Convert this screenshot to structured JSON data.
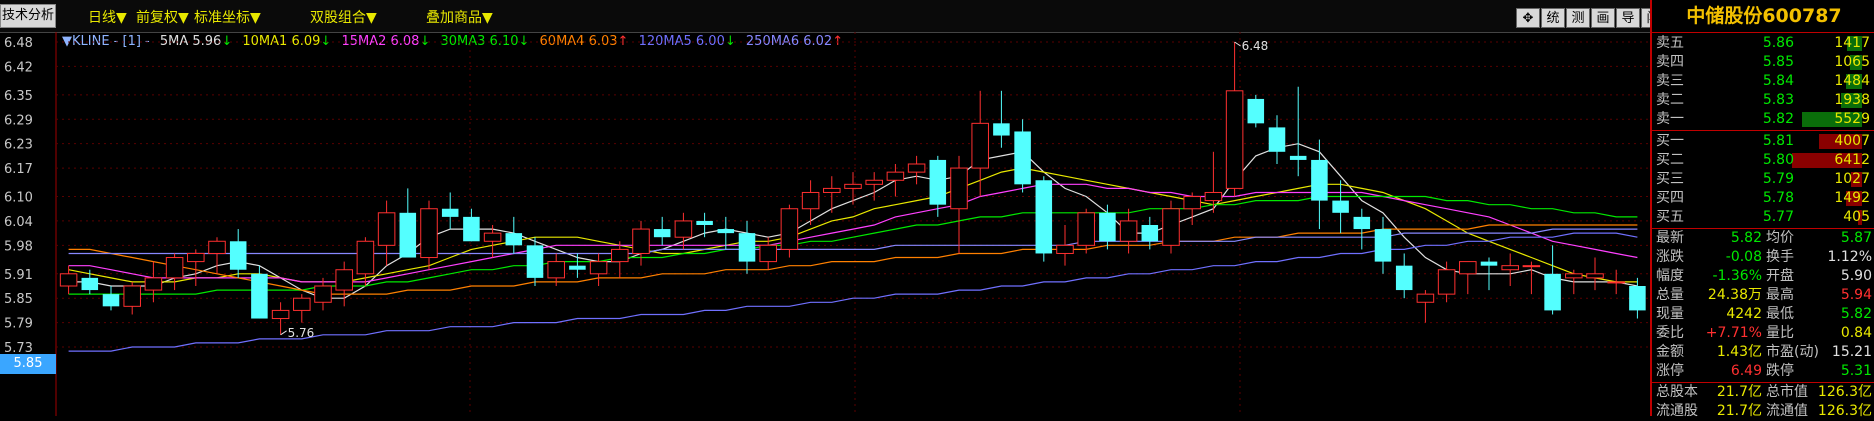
{
  "toolbar": {
    "left_tab": "技术分析",
    "menus": [
      {
        "label": "日线▼"
      },
      {
        "label": "前复权▼"
      },
      {
        "label": "标准坐标▼"
      },
      {
        "label": "双股组合▼"
      },
      {
        "label": "叠加商品▼"
      }
    ],
    "buttons": [
      "✥",
      "统",
      "测",
      "画",
      "导",
      "闯"
    ]
  },
  "legend": {
    "kline": "▼KLINE - [1] -",
    "items": [
      {
        "label": "5MA 5.96",
        "arrow": "↓",
        "color": "#e0e0e0"
      },
      {
        "label": "10MA1 6.09",
        "arrow": "↓",
        "color": "#e8e800"
      },
      {
        "label": "15MA2 6.08",
        "arrow": "↓",
        "color": "#ff40ff"
      },
      {
        "label": "30MA3 6.10",
        "arrow": "↓",
        "color": "#00e800"
      },
      {
        "label": "60MA4 6.03",
        "arrow": "↑",
        "color": "#ff8000"
      },
      {
        "label": "120MA5 6.00",
        "arrow": "↓",
        "color": "#7070ff"
      },
      {
        "label": "250MA6 6.02",
        "arrow": "↑",
        "color": "#8888ff"
      }
    ]
  },
  "current_price_badge": "5.85",
  "annotations": {
    "high": "6.48",
    "low": "5.76"
  },
  "chart_data": {
    "type": "candlestick",
    "yticks": [
      "6.48",
      "6.42",
      "6.35",
      "6.29",
      "6.23",
      "6.17",
      "6.10",
      "6.04",
      "5.98",
      "5.91",
      "5.85",
      "5.79",
      "5.73"
    ],
    "ylim": [
      5.73,
      6.5
    ],
    "colors": {
      "up": "#ff3030",
      "down": "#54ffff"
    },
    "candles": [
      [
        5.88,
        5.93,
        5.86,
        5.91
      ],
      [
        5.9,
        5.92,
        5.86,
        5.87
      ],
      [
        5.86,
        5.88,
        5.82,
        5.83
      ],
      [
        5.83,
        5.89,
        5.81,
        5.88
      ],
      [
        5.87,
        5.94,
        5.84,
        5.9
      ],
      [
        5.9,
        5.96,
        5.87,
        5.95
      ],
      [
        5.94,
        5.97,
        5.88,
        5.96
      ],
      [
        5.96,
        6.0,
        5.91,
        5.99
      ],
      [
        5.99,
        6.02,
        5.9,
        5.92
      ],
      [
        5.91,
        5.93,
        5.8,
        5.8
      ],
      [
        5.8,
        5.84,
        5.76,
        5.82
      ],
      [
        5.82,
        5.86,
        5.79,
        5.85
      ],
      [
        5.84,
        5.9,
        5.82,
        5.88
      ],
      [
        5.87,
        5.94,
        5.83,
        5.92
      ],
      [
        5.91,
        6.0,
        5.88,
        5.99
      ],
      [
        5.98,
        6.09,
        5.93,
        6.06
      ],
      [
        6.06,
        6.12,
        5.96,
        5.95
      ],
      [
        5.95,
        6.09,
        5.92,
        6.07
      ],
      [
        6.07,
        6.11,
        6.02,
        6.05
      ],
      [
        6.05,
        6.07,
        5.99,
        5.99
      ],
      [
        5.99,
        6.03,
        5.95,
        6.01
      ],
      [
        6.01,
        6.05,
        5.96,
        5.98
      ],
      [
        5.98,
        6.0,
        5.88,
        5.9
      ],
      [
        5.9,
        5.96,
        5.88,
        5.94
      ],
      [
        5.93,
        5.96,
        5.9,
        5.92
      ],
      [
        5.91,
        5.96,
        5.88,
        5.94
      ],
      [
        5.94,
        5.99,
        5.9,
        5.97
      ],
      [
        5.96,
        6.04,
        5.93,
        6.02
      ],
      [
        6.02,
        6.05,
        5.98,
        6.0
      ],
      [
        6.0,
        6.06,
        5.97,
        6.04
      ],
      [
        6.04,
        6.06,
        6.0,
        6.03
      ],
      [
        6.02,
        6.05,
        5.97,
        6.01
      ],
      [
        6.01,
        6.04,
        5.91,
        5.94
      ],
      [
        5.94,
        6.0,
        5.92,
        5.98
      ],
      [
        5.97,
        6.08,
        5.95,
        6.07
      ],
      [
        6.07,
        6.14,
        6.03,
        6.11
      ],
      [
        6.11,
        6.15,
        6.06,
        6.12
      ],
      [
        6.12,
        6.16,
        6.08,
        6.13
      ],
      [
        6.13,
        6.16,
        6.09,
        6.14
      ],
      [
        6.14,
        6.18,
        6.1,
        6.16
      ],
      [
        6.16,
        6.2,
        6.13,
        6.18
      ],
      [
        6.19,
        6.2,
        6.05,
        6.08
      ],
      [
        6.07,
        6.2,
        5.96,
        6.17
      ],
      [
        6.17,
        6.36,
        6.1,
        6.28
      ],
      [
        6.28,
        6.36,
        6.22,
        6.25
      ],
      [
        6.26,
        6.29,
        6.11,
        6.13
      ],
      [
        6.14,
        6.15,
        5.94,
        5.96
      ],
      [
        5.96,
        6.03,
        5.93,
        5.98
      ],
      [
        5.98,
        6.07,
        5.96,
        6.06
      ],
      [
        6.06,
        6.08,
        5.97,
        5.99
      ],
      [
        5.99,
        6.07,
        5.96,
        6.04
      ],
      [
        6.03,
        6.05,
        5.97,
        5.99
      ],
      [
        5.98,
        6.09,
        5.96,
        6.07
      ],
      [
        6.07,
        6.11,
        6.03,
        6.1
      ],
      [
        6.09,
        6.21,
        6.06,
        6.11
      ],
      [
        6.12,
        6.48,
        6.1,
        6.36
      ],
      [
        6.34,
        6.35,
        6.27,
        6.28
      ],
      [
        6.27,
        6.3,
        6.18,
        6.21
      ],
      [
        6.2,
        6.37,
        6.15,
        6.19
      ],
      [
        6.19,
        6.24,
        6.02,
        6.09
      ],
      [
        6.09,
        6.14,
        6.01,
        6.06
      ],
      [
        6.05,
        6.07,
        5.97,
        6.02
      ],
      [
        6.02,
        6.05,
        5.91,
        5.94
      ],
      [
        5.93,
        5.96,
        5.85,
        5.87
      ],
      [
        5.84,
        5.87,
        5.79,
        5.86
      ],
      [
        5.86,
        5.94,
        5.84,
        5.92
      ],
      [
        5.91,
        5.94,
        5.86,
        5.94
      ],
      [
        5.94,
        5.95,
        5.87,
        5.93
      ],
      [
        5.92,
        5.96,
        5.88,
        5.93
      ],
      [
        5.93,
        5.94,
        5.86,
        5.93
      ],
      [
        5.91,
        5.98,
        5.81,
        5.82
      ],
      [
        5.9,
        5.92,
        5.86,
        5.91
      ],
      [
        5.9,
        5.95,
        5.87,
        5.91
      ],
      [
        5.89,
        5.92,
        5.86,
        5.89
      ],
      [
        5.88,
        5.9,
        5.8,
        5.82
      ]
    ],
    "ma_lines": [
      {
        "name": "5MA",
        "color": "#e0e0e0",
        "values": [
          5.89,
          5.89,
          5.88,
          5.88,
          5.88,
          5.9,
          5.91,
          5.93,
          5.94,
          5.93,
          5.9,
          5.87,
          5.85,
          5.85,
          5.88,
          5.93,
          5.96,
          6.0,
          6.02,
          6.02,
          6.02,
          6.01,
          5.99,
          5.97,
          5.95,
          5.94,
          5.94,
          5.96,
          5.97,
          5.99,
          6.01,
          6.02,
          6.01,
          6.0,
          6.01,
          6.04,
          6.07,
          6.09,
          6.11,
          6.14,
          6.15,
          6.14,
          6.15,
          6.19,
          6.2,
          6.21,
          6.16,
          6.12,
          6.1,
          6.06,
          6.01,
          6.01,
          6.03,
          6.05,
          6.07,
          6.14,
          6.2,
          6.22,
          6.23,
          6.21,
          6.15,
          6.09,
          6.06,
          6.0,
          5.95,
          5.92,
          5.91,
          5.91,
          5.91,
          5.92,
          5.9,
          5.89,
          5.89,
          5.89,
          5.88
        ]
      },
      {
        "name": "10MA1",
        "color": "#e8e800",
        "values": [
          5.92,
          5.91,
          5.9,
          5.89,
          5.89,
          5.89,
          5.9,
          5.9,
          5.91,
          5.91,
          5.9,
          5.89,
          5.89,
          5.89,
          5.9,
          5.91,
          5.92,
          5.93,
          5.95,
          5.97,
          5.98,
          5.99,
          6.0,
          6.0,
          6.0,
          5.99,
          5.98,
          5.97,
          5.96,
          5.96,
          5.97,
          5.98,
          5.99,
          5.99,
          6.0,
          6.02,
          6.04,
          6.05,
          6.07,
          6.08,
          6.09,
          6.1,
          6.12,
          6.14,
          6.16,
          6.17,
          6.16,
          6.15,
          6.14,
          6.13,
          6.12,
          6.11,
          6.1,
          6.09,
          6.08,
          6.09,
          6.1,
          6.11,
          6.12,
          6.13,
          6.13,
          6.12,
          6.11,
          6.09,
          6.07,
          6.04,
          6.01,
          5.99,
          5.97,
          5.95,
          5.93,
          5.91,
          5.9,
          5.89,
          5.89
        ]
      },
      {
        "name": "15MA2",
        "color": "#ff40ff",
        "values": [
          5.93,
          5.93,
          5.92,
          5.91,
          5.9,
          5.9,
          5.9,
          5.9,
          5.9,
          5.9,
          5.9,
          5.89,
          5.89,
          5.89,
          5.89,
          5.9,
          5.91,
          5.92,
          5.93,
          5.94,
          5.95,
          5.96,
          5.97,
          5.98,
          5.98,
          5.98,
          5.98,
          5.98,
          5.98,
          5.98,
          5.98,
          5.98,
          5.98,
          5.98,
          5.99,
          6.0,
          6.01,
          6.02,
          6.03,
          6.05,
          6.06,
          6.07,
          6.08,
          6.1,
          6.11,
          6.12,
          6.13,
          6.13,
          6.13,
          6.12,
          6.12,
          6.11,
          6.11,
          6.1,
          6.1,
          6.1,
          6.11,
          6.11,
          6.11,
          6.11,
          6.11,
          6.11,
          6.1,
          6.09,
          6.08,
          6.07,
          6.06,
          6.05,
          6.03,
          6.01,
          5.99,
          5.98,
          5.97,
          5.96,
          5.95
        ]
      },
      {
        "name": "30MA3",
        "color": "#00e800",
        "values": [
          5.86,
          5.86,
          5.86,
          5.86,
          5.86,
          5.86,
          5.86,
          5.87,
          5.87,
          5.87,
          5.87,
          5.87,
          5.88,
          5.88,
          5.88,
          5.89,
          5.89,
          5.9,
          5.91,
          5.92,
          5.92,
          5.93,
          5.93,
          5.94,
          5.94,
          5.94,
          5.95,
          5.95,
          5.95,
          5.96,
          5.96,
          5.97,
          5.97,
          5.98,
          5.98,
          5.99,
          5.99,
          6.0,
          6.01,
          6.02,
          6.03,
          6.03,
          6.04,
          6.05,
          6.05,
          6.06,
          6.06,
          6.06,
          6.06,
          6.06,
          6.06,
          6.07,
          6.07,
          6.07,
          6.08,
          6.08,
          6.09,
          6.09,
          6.09,
          6.1,
          6.1,
          6.1,
          6.1,
          6.1,
          6.1,
          6.09,
          6.09,
          6.08,
          6.08,
          6.07,
          6.07,
          6.06,
          6.06,
          6.05,
          6.05
        ]
      },
      {
        "name": "60MA4",
        "color": "#ff8000",
        "values": [
          5.97,
          5.97,
          5.96,
          5.95,
          5.94,
          5.93,
          5.92,
          5.91,
          5.9,
          5.89,
          5.88,
          5.87,
          5.86,
          5.86,
          5.86,
          5.86,
          5.87,
          5.87,
          5.87,
          5.88,
          5.88,
          5.88,
          5.89,
          5.89,
          5.89,
          5.9,
          5.9,
          5.9,
          5.91,
          5.91,
          5.91,
          5.92,
          5.92,
          5.92,
          5.93,
          5.93,
          5.94,
          5.94,
          5.94,
          5.95,
          5.95,
          5.95,
          5.96,
          5.96,
          5.96,
          5.97,
          5.97,
          5.97,
          5.97,
          5.98,
          5.98,
          5.98,
          5.99,
          5.99,
          5.99,
          6.0,
          6.0,
          6.0,
          6.01,
          6.01,
          6.01,
          6.01,
          6.02,
          6.02,
          6.02,
          6.02,
          6.02,
          6.03,
          6.03,
          6.03,
          6.03,
          6.03,
          6.03,
          6.03,
          6.03
        ]
      },
      {
        "name": "120MA5",
        "color": "#7070ff",
        "values": [
          5.72,
          5.72,
          5.72,
          5.73,
          5.73,
          5.73,
          5.74,
          5.74,
          5.74,
          5.75,
          5.75,
          5.75,
          5.76,
          5.76,
          5.76,
          5.77,
          5.77,
          5.77,
          5.78,
          5.78,
          5.78,
          5.79,
          5.79,
          5.79,
          5.8,
          5.8,
          5.8,
          5.81,
          5.81,
          5.81,
          5.82,
          5.82,
          5.83,
          5.83,
          5.83,
          5.84,
          5.84,
          5.85,
          5.85,
          5.86,
          5.86,
          5.86,
          5.87,
          5.87,
          5.88,
          5.88,
          5.89,
          5.89,
          5.9,
          5.9,
          5.91,
          5.91,
          5.92,
          5.92,
          5.93,
          5.93,
          5.94,
          5.94,
          5.95,
          5.95,
          5.96,
          5.96,
          5.97,
          5.97,
          5.98,
          5.98,
          5.99,
          5.99,
          6.0,
          6.0,
          6.0,
          6.01,
          6.01,
          6.01,
          6.0
        ]
      },
      {
        "name": "250MA6",
        "color": "#8888ff",
        "values": [
          5.96,
          5.96,
          5.96,
          5.96,
          5.96,
          5.96,
          5.96,
          5.96,
          5.96,
          5.96,
          5.96,
          5.96,
          5.96,
          5.96,
          5.96,
          5.96,
          5.96,
          5.96,
          5.96,
          5.96,
          5.96,
          5.96,
          5.96,
          5.96,
          5.96,
          5.96,
          5.96,
          5.96,
          5.97,
          5.97,
          5.97,
          5.97,
          5.97,
          5.97,
          5.97,
          5.97,
          5.97,
          5.97,
          5.97,
          5.98,
          5.98,
          5.98,
          5.98,
          5.98,
          5.98,
          5.98,
          5.98,
          5.98,
          5.99,
          5.99,
          5.99,
          5.99,
          5.99,
          5.99,
          5.99,
          5.99,
          6.0,
          6.0,
          6.0,
          6.0,
          6.0,
          6.0,
          6.0,
          6.01,
          6.01,
          6.01,
          6.01,
          6.01,
          6.01,
          6.01,
          6.02,
          6.02,
          6.02,
          6.02,
          6.02
        ]
      }
    ]
  },
  "quote": {
    "title": "中储股份600787",
    "asks": [
      {
        "label": "卖五",
        "price": "5.86",
        "vol": "1417",
        "bar_frac": 0.22
      },
      {
        "label": "卖四",
        "price": "5.85",
        "vol": "1065",
        "bar_frac": 0.17
      },
      {
        "label": "卖三",
        "price": "5.84",
        "vol": "1484",
        "bar_frac": 0.23
      },
      {
        "label": "卖二",
        "price": "5.83",
        "vol": "1938",
        "bar_frac": 0.3
      },
      {
        "label": "卖一",
        "price": "5.82",
        "vol": "5529",
        "bar_frac": 0.86
      }
    ],
    "bids": [
      {
        "label": "买一",
        "price": "5.81",
        "vol": "4007",
        "bar_frac": 0.62
      },
      {
        "label": "买二",
        "price": "5.80",
        "vol": "6412",
        "bar_frac": 1.0
      },
      {
        "label": "买三",
        "price": "5.79",
        "vol": "1027",
        "bar_frac": 0.16
      },
      {
        "label": "买四",
        "price": "5.78",
        "vol": "1492",
        "bar_frac": 0.23
      },
      {
        "label": "买五",
        "price": "5.77",
        "vol": "405",
        "bar_frac": 0.06
      }
    ],
    "stats": [
      {
        "l1": "最新",
        "v1": "5.82",
        "c1": "g",
        "l2": "均价",
        "v2": "5.87",
        "c2": "g"
      },
      {
        "l1": "涨跌",
        "v1": "-0.08",
        "c1": "g",
        "l2": "换手",
        "v2": "1.12%",
        "c2": "w"
      },
      {
        "l1": "幅度",
        "v1": "-1.36%",
        "c1": "g",
        "l2": "开盘",
        "v2": "5.90",
        "c2": "w"
      },
      {
        "l1": "总量",
        "v1": "24.38万",
        "c1": "y",
        "l2": "最高",
        "v2": "5.94",
        "c2": "r"
      },
      {
        "l1": "现量",
        "v1": "4242",
        "c1": "y",
        "l2": "最低",
        "v2": "5.82",
        "c2": "g"
      },
      {
        "l1": "委比",
        "v1": "+7.71%",
        "c1": "r",
        "l2": "量比",
        "v2": "0.84",
        "c2": "y"
      },
      {
        "l1": "金额",
        "v1": "1.43亿",
        "c1": "y",
        "l2": "市盈(动)",
        "v2": "15.21",
        "c2": "w"
      },
      {
        "l1": "涨停",
        "v1": "6.49",
        "c1": "r",
        "l2": "跌停",
        "v2": "5.31",
        "c2": "g"
      }
    ],
    "capital": [
      {
        "l1": "总股本",
        "v1": "21.7亿",
        "l2": "总市值",
        "v2": "126.3亿"
      },
      {
        "l1": "流通股",
        "v1": "21.7亿",
        "l2": "流通值",
        "v2": "126.3亿"
      }
    ]
  }
}
